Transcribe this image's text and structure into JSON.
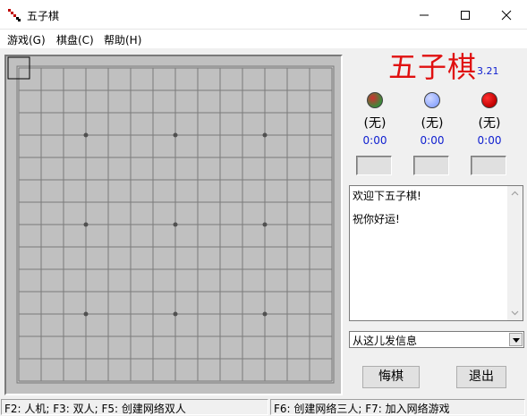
{
  "window": {
    "title": "五子棋",
    "icon": "gomoku-app-icon",
    "controls": [
      "minimize-icon",
      "maximize-icon",
      "close-icon"
    ]
  },
  "menu": {
    "items": [
      {
        "label": "游戏(G)"
      },
      {
        "label": "棋盘(C)"
      },
      {
        "label": "帮助(H)"
      }
    ]
  },
  "board": {
    "size": 15,
    "background": "#c0c0c0",
    "grid_color": "#7a7a7a",
    "star_points": [
      [
        3,
        3
      ],
      [
        3,
        7
      ],
      [
        3,
        11
      ],
      [
        7,
        3
      ],
      [
        7,
        7
      ],
      [
        7,
        11
      ],
      [
        11,
        3
      ],
      [
        11,
        7
      ],
      [
        11,
        11
      ]
    ],
    "cursor": [
      0,
      0
    ]
  },
  "side": {
    "logo": "五子棋",
    "version": "3.21",
    "logo_color": "#e01010",
    "players": [
      {
        "color": "#3a8a3a",
        "accent": "#d03030",
        "name": "(无)",
        "time": "0:00"
      },
      {
        "color": "#8fa8ff",
        "accent": "#d0d8ff",
        "name": "(无)",
        "time": "0:00"
      },
      {
        "color": "#c00000",
        "accent": "#ff3030",
        "name": "(无)",
        "time": "0:00"
      }
    ],
    "chat_lines": [
      "欢迎下五子棋!",
      "祝你好运!"
    ],
    "chat_input": "从这儿发信息",
    "buttons": {
      "undo": "悔棋",
      "exit": "退出"
    }
  },
  "status": {
    "left": "F2: 人机; F3: 双人; F5: 创建网络双人",
    "right": "F6: 创建网络三人; F7: 加入网络游戏"
  }
}
